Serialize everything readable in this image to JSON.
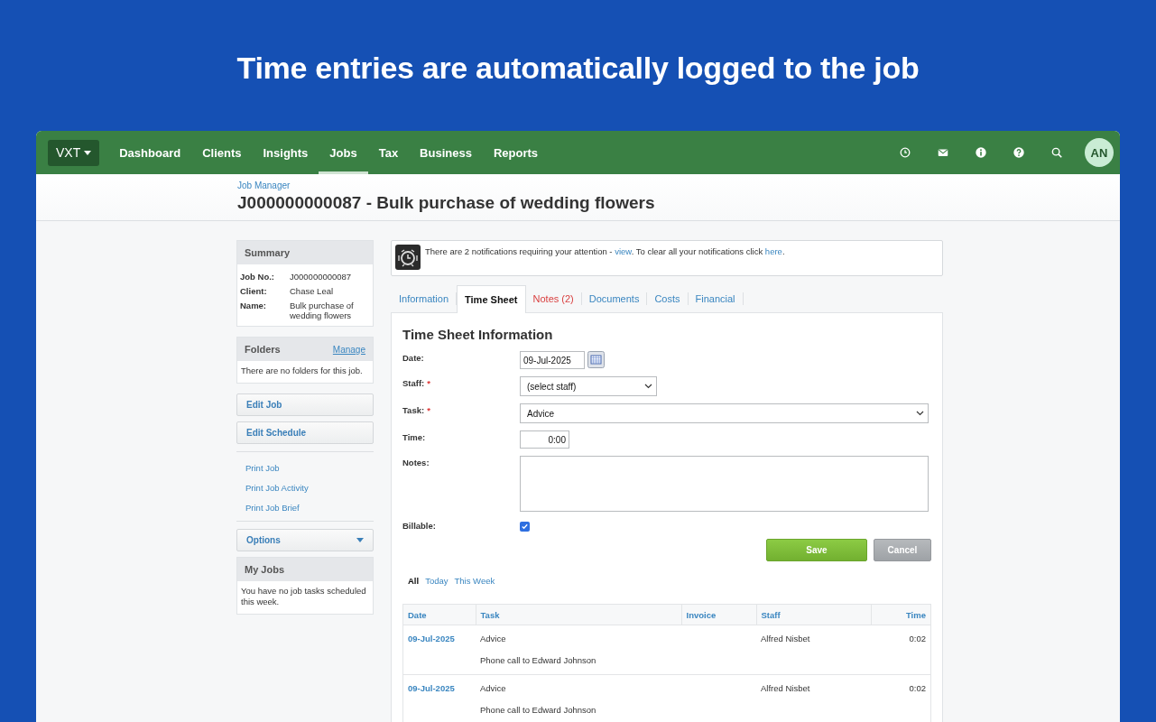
{
  "headline": "Time entries are automatically logged to the job",
  "nav": {
    "brand": "VXT",
    "items": [
      {
        "label": "Dashboard",
        "selected": false
      },
      {
        "label": "Clients",
        "selected": false
      },
      {
        "label": "Insights",
        "selected": false
      },
      {
        "label": "Jobs",
        "selected": true
      },
      {
        "label": "Tax",
        "selected": false
      },
      {
        "label": "Business",
        "selected": false
      },
      {
        "label": "Reports",
        "selected": false
      }
    ],
    "icons": [
      {
        "kind": "clock"
      },
      {
        "kind": "mail"
      },
      {
        "kind": "info"
      },
      {
        "kind": "help"
      },
      {
        "kind": "search"
      }
    ],
    "avatar": "AN"
  },
  "header": {
    "breadcrumb": "Job Manager",
    "title": "J000000000087 - Bulk purchase of wedding flowers"
  },
  "sidebar": {
    "summary": {
      "title": "Summary",
      "rows": [
        {
          "label": "Job No.:",
          "value": "J000000000087"
        },
        {
          "label": "Client:",
          "value": "Chase Leal"
        },
        {
          "label": "Name:",
          "value": "Bulk purchase of wedding flowers"
        }
      ]
    },
    "folders": {
      "title": "Folders",
      "action": "Manage",
      "text": "There are no folders for this job."
    },
    "buttons": [
      "Edit Job",
      "Edit Schedule"
    ],
    "links": [
      "Print Job",
      "Print Job Activity",
      "Print Job Brief"
    ],
    "options": "Options",
    "my_jobs": {
      "title": "My Jobs",
      "text": "You have no job tasks scheduled this week."
    }
  },
  "notice": [
    {
      "kind": "text",
      "text": "There are 2 notifications requiring your attention - "
    },
    {
      "kind": "link",
      "text": "view"
    },
    {
      "kind": "text",
      "text": ". To clear all your notifications click "
    },
    {
      "kind": "link",
      "text": "here"
    },
    {
      "kind": "text",
      "text": "."
    }
  ],
  "tabs": [
    {
      "label": "Information",
      "selected": false,
      "alert": false
    },
    {
      "label": "Time Sheet",
      "selected": true,
      "alert": false
    },
    {
      "label": "Notes (2)",
      "selected": false,
      "alert": true
    },
    {
      "label": "Documents",
      "selected": false,
      "alert": false
    },
    {
      "label": "Costs",
      "selected": false,
      "alert": false
    },
    {
      "label": "Financial",
      "selected": false,
      "alert": false
    }
  ],
  "form": {
    "title": "Time Sheet Information",
    "fields": [
      {
        "kind": "date",
        "label": "Date:",
        "value": "09-Jul-2025"
      },
      {
        "kind": "select",
        "label": "Staff:",
        "required_mark": "*",
        "value": "(select staff)"
      },
      {
        "kind": "select-wide",
        "label": "Task:",
        "required_mark": "*",
        "value": "Advice"
      },
      {
        "kind": "time",
        "label": "Time:",
        "value": "0:00"
      },
      {
        "kind": "textarea",
        "label": "Notes:"
      },
      {
        "kind": "checkbox",
        "label": "Billable:",
        "checked": true
      }
    ],
    "buttons": [
      {
        "kind": "primary",
        "label": "Save"
      },
      {
        "kind": "secondary",
        "label": "Cancel"
      }
    ]
  },
  "filters": [
    {
      "label": "All",
      "selected": true
    },
    {
      "label": "Today",
      "selected": false
    },
    {
      "label": "This Week",
      "selected": false
    }
  ],
  "table": {
    "columns": [
      "Date",
      "Task",
      "Invoice",
      "Staff",
      "Time"
    ],
    "rows": [
      {
        "date": "09-Jul-2025",
        "task": "Advice",
        "note": "Phone call to Edward Johnson",
        "staff": "Alfred Nisbet",
        "time": "0:02"
      },
      {
        "date": "09-Jul-2025",
        "task": "Advice",
        "note": "Phone call to Edward Johnson",
        "staff": "Alfred Nisbet",
        "time": "0:02"
      }
    ]
  }
}
